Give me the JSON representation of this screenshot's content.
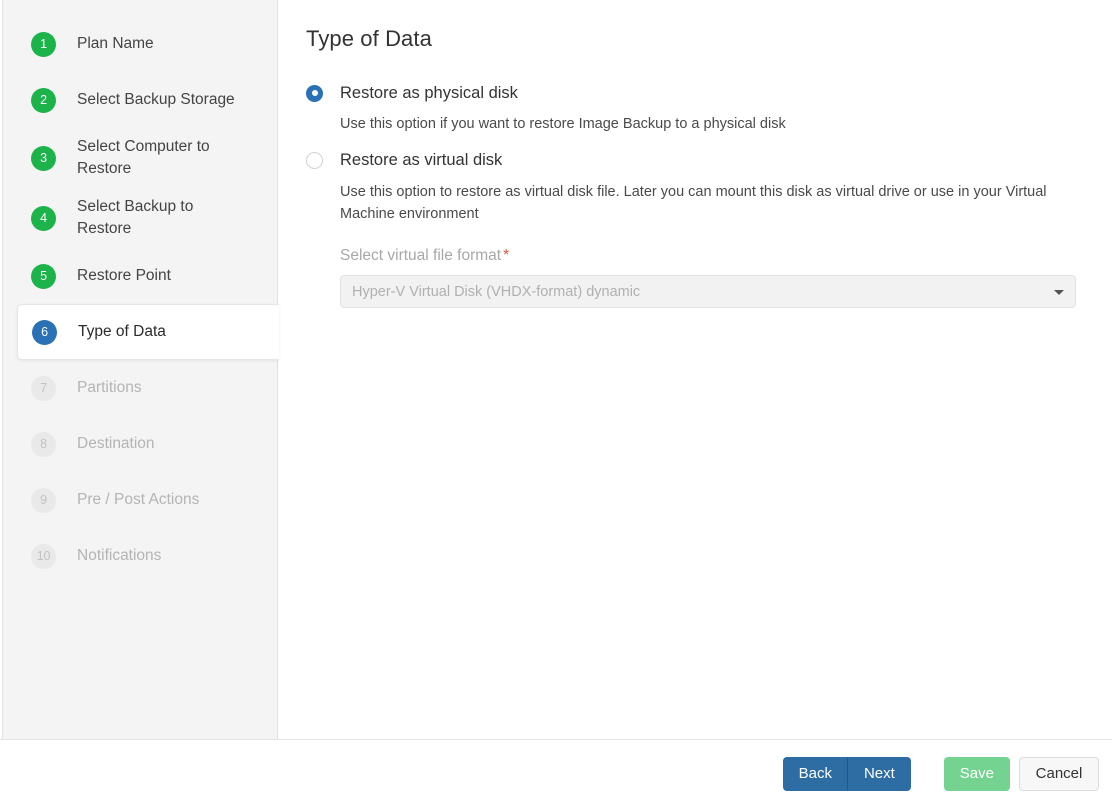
{
  "sidebar": {
    "steps": [
      {
        "number": "1",
        "label": "Plan Name",
        "state": "done"
      },
      {
        "number": "2",
        "label": "Select Backup Storage",
        "state": "done"
      },
      {
        "number": "3",
        "label": "Select Computer to Restore",
        "state": "done"
      },
      {
        "number": "4",
        "label": "Select Backup to Restore",
        "state": "done"
      },
      {
        "number": "5",
        "label": "Restore Point",
        "state": "done"
      },
      {
        "number": "6",
        "label": "Type of Data",
        "state": "current"
      },
      {
        "number": "7",
        "label": "Partitions",
        "state": "disabled"
      },
      {
        "number": "8",
        "label": "Destination",
        "state": "disabled"
      },
      {
        "number": "9",
        "label": "Pre / Post Actions",
        "state": "disabled"
      },
      {
        "number": "10",
        "label": "Notifications",
        "state": "disabled"
      }
    ]
  },
  "main": {
    "title": "Type of Data",
    "options": [
      {
        "label": "Restore as physical disk",
        "description": "Use this option if you want to restore Image Backup to a physical disk",
        "selected": true
      },
      {
        "label": "Restore as virtual disk",
        "description": "Use this option to restore as virtual disk file. Later you can mount this disk as virtual drive or use in your Virtual Machine environment",
        "selected": false
      }
    ],
    "virtual_format_field": {
      "label": "Select virtual file format",
      "required_mark": "*",
      "selected_value": "Hyper-V Virtual Disk (VHDX-format) dynamic"
    }
  },
  "footer": {
    "back_label": "Back",
    "next_label": "Next",
    "save_label": "Save",
    "cancel_label": "Cancel"
  },
  "colors": {
    "step_done": "#1cb34a",
    "step_current": "#2a72b5",
    "step_disabled": "#e9e9e9",
    "primary_button": "#2e6da4",
    "save_button": "#74d391",
    "required_asterisk": "#e8513b"
  }
}
